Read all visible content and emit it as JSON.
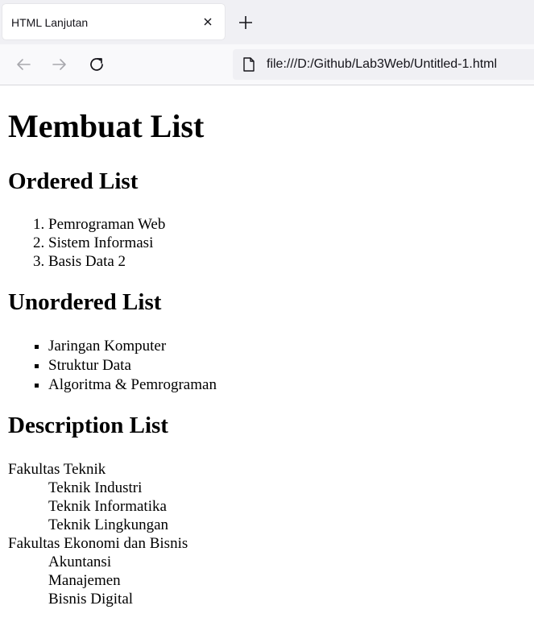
{
  "browser": {
    "tab_title": "HTML Lanjutan",
    "url": "file:///D:/Github/Lab3Web/Untitled-1.html"
  },
  "page": {
    "h1": "Membuat List",
    "ordered": {
      "heading": "Ordered List",
      "items": [
        "Pemrograman Web",
        "Sistem Informasi",
        "Basis Data 2"
      ]
    },
    "unordered": {
      "heading": "Unordered List",
      "items": [
        "Jaringan Komputer",
        "Struktur Data",
        "Algoritma & Pemrograman"
      ]
    },
    "description": {
      "heading": "Description List",
      "groups": [
        {
          "term": "Fakultas Teknik",
          "defs": [
            "Teknik Industri",
            "Teknik Informatika",
            "Teknik Lingkungan"
          ]
        },
        {
          "term": "Fakultas Ekonomi dan Bisnis",
          "defs": [
            "Akuntansi",
            "Manajemen",
            "Bisnis Digital"
          ]
        }
      ]
    }
  }
}
